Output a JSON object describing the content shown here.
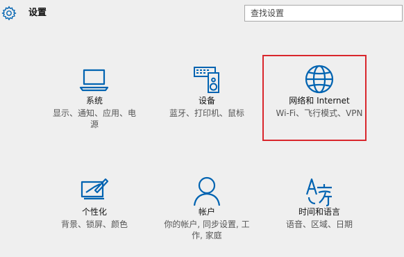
{
  "header": {
    "title": "设置",
    "search_placeholder": "查找设置"
  },
  "tiles": [
    {
      "name": "系统",
      "desc": "显示、通知、应用、电源",
      "icon": "laptop-icon"
    },
    {
      "name": "设备",
      "desc": "蓝牙、打印机、鼠标",
      "icon": "devices-icon"
    },
    {
      "name": "网络和 Internet",
      "desc": "Wi-Fi、飞行模式、VPN",
      "icon": "globe-icon"
    },
    {
      "name": "个性化",
      "desc": "背景、锁屏、颜色",
      "icon": "personalization-icon"
    },
    {
      "name": "帐户",
      "desc": "你的帐户, 同步设置, 工作, 家庭",
      "icon": "person-icon"
    },
    {
      "name": "时间和语言",
      "desc": "语音、区域、日期",
      "icon": "time-language-icon"
    }
  ],
  "colors": {
    "accent": "#0063b1",
    "highlight": "#d9262c",
    "background": "#efefef"
  }
}
